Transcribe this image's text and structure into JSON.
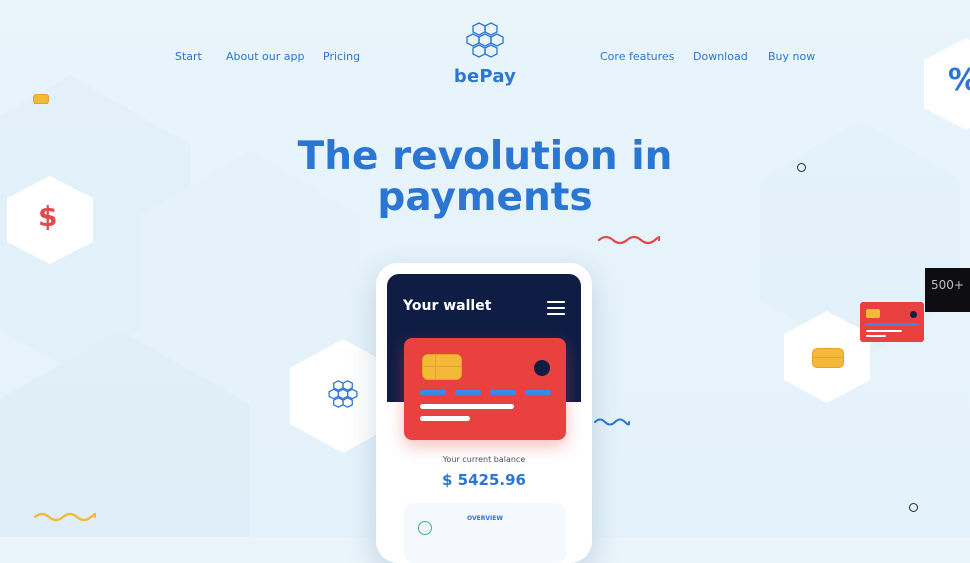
{
  "brand": {
    "name": "bePay"
  },
  "nav": {
    "left": [
      "Start",
      "About our app",
      "Pricing"
    ],
    "right": [
      "Core features",
      "Download"
    ],
    "buy": "Buy now"
  },
  "hero": {
    "line1": "The revolution in",
    "line2": "payments"
  },
  "phone": {
    "wallet_title": "Your wallet",
    "balance_label": "Your current balance",
    "balance_value": "$ 5425.96",
    "overview_label": "OVERVIEW"
  },
  "decor": {
    "dollar": "$",
    "percent": "%",
    "promo": "500+"
  },
  "colors": {
    "primary": "#2a76d2",
    "accent": "#e14a4a",
    "navy": "#0f1d45",
    "chip": "#f5b93a"
  },
  "icons": [
    "logo-cubes-icon",
    "menu-icon",
    "card-chip-icon",
    "cube-network-icon"
  ]
}
